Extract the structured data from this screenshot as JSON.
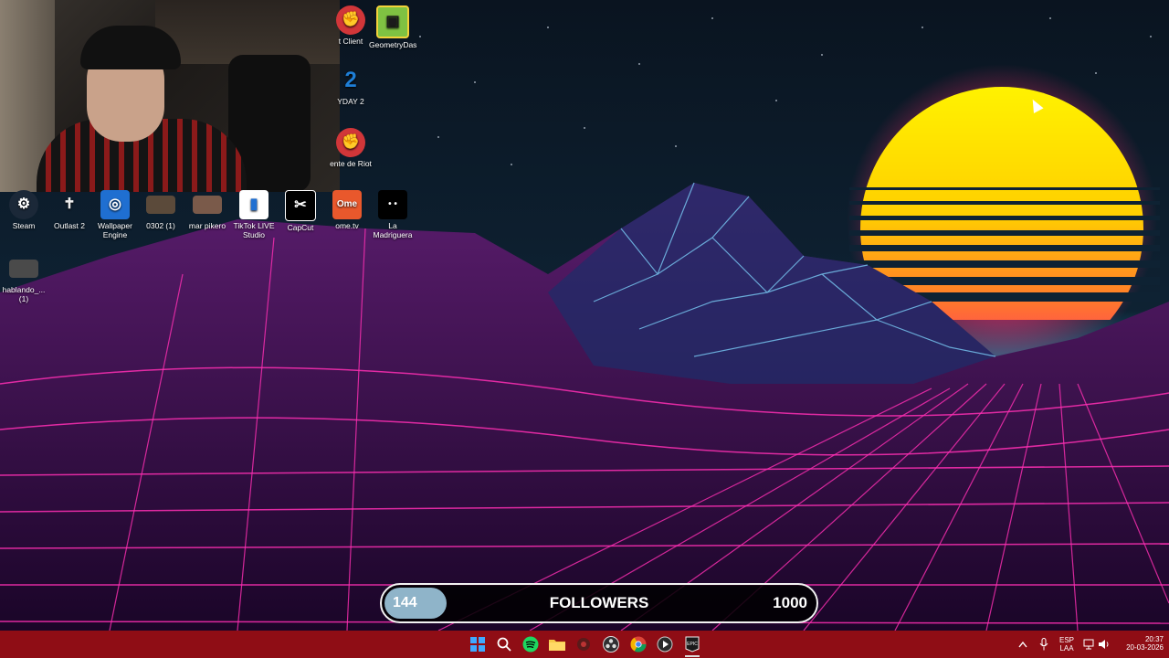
{
  "desktop": {
    "icons": [
      {
        "label": "t Client",
        "icon": "riot-client-icon",
        "color": "#d13639"
      },
      {
        "label": "GeometryDas",
        "icon": "geometry-dash-icon",
        "color": "#7fc242"
      },
      {
        "label": "YDAY 2",
        "icon": "payday-2-icon",
        "color": "#1e7ed6"
      },
      {
        "label": "ente de Riot",
        "icon": "riot-client-icon",
        "color": "#d13639"
      },
      {
        "label": "Steam",
        "icon": "steam-icon",
        "color": "#1b2838"
      },
      {
        "label": "Outlast 2",
        "icon": "outlast-2-icon",
        "color": "#111111"
      },
      {
        "label": "Wallpaper Engine",
        "icon": "wallpaper-engine-icon",
        "color": "#1f6fd1"
      },
      {
        "label": "0302 (1)",
        "icon": "video-thumbnail-icon",
        "color": "#5b4a3a"
      },
      {
        "label": "mar pikero",
        "icon": "video-thumbnail-icon",
        "color": "#7a5a4a"
      },
      {
        "label": "TikTok LIVE Studio",
        "icon": "tiktok-live-studio-icon",
        "color": "#ffffff"
      },
      {
        "label": "CapCut",
        "icon": "capcut-icon",
        "color": "#000000"
      },
      {
        "label": "ome.tv",
        "icon": "ome-tv-icon",
        "color": "#e9582c"
      },
      {
        "label": "La Madriguera",
        "icon": "eyes-icon",
        "color": "#000000"
      },
      {
        "label": "hablando_... (1)",
        "icon": "video-thumbnail-icon",
        "color": "#4a4a4a"
      }
    ]
  },
  "followers_bar": {
    "current": "144",
    "title": "FOLLOWERS",
    "goal": "1000",
    "progress_fraction": 0.144,
    "fill_color": "#8fb4c9"
  },
  "taskbar": {
    "color": "#8f0d15",
    "apps": [
      "windows-start-icon",
      "search-icon",
      "spotify-icon",
      "file-explorer-icon",
      "app-icon",
      "obs-icon",
      "chrome-icon",
      "media-player-icon",
      "epic-games-icon"
    ],
    "tray": {
      "language": "ESP",
      "layout": "LAA",
      "time": "20:37",
      "date": "20-03-2026"
    }
  }
}
